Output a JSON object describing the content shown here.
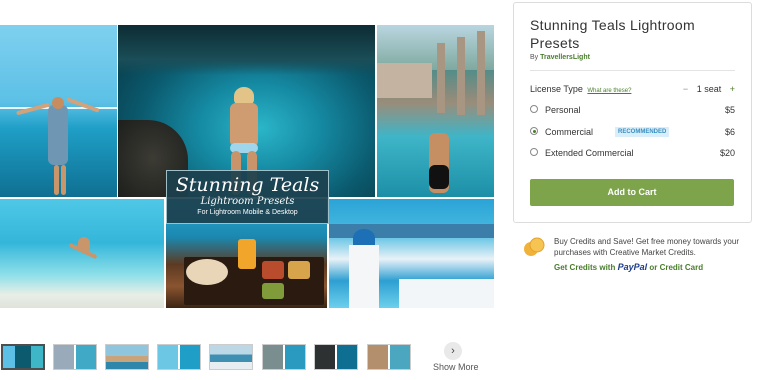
{
  "gallery": {
    "overlay_title": "Stunning Teals",
    "overlay_subtitle": "Lightroom Presets",
    "overlay_caption": "For Lightroom Mobile & Desktop",
    "show_more_icon": "chevron-right-icon",
    "show_more_label": "Show More",
    "thumbnail_count": 8
  },
  "product": {
    "title": "Stunning Teals Lightroom Presets",
    "by_prefix": "By",
    "shop_name": "TravellersLight",
    "license_label": "License Type",
    "what_link": "What are these?",
    "seat_minus": "−",
    "seat_value": "1 seat",
    "seat_plus": "+",
    "options": [
      {
        "name": "Personal",
        "price": "$5",
        "selected": false,
        "badge": ""
      },
      {
        "name": "Commercial",
        "price": "$6",
        "selected": true,
        "badge": "RECOMMENDED"
      },
      {
        "name": "Extended Commercial",
        "price": "$20",
        "selected": false,
        "badge": ""
      }
    ],
    "add_to_cart": "Add to Cart"
  },
  "credits": {
    "text": "Buy Credits and Save! Get free money towards your purchases with Creative Market Credits.",
    "link_prefix": "Get Credits with",
    "paypal": "PayPal",
    "link_suffix": "or Credit Card"
  },
  "colors": {
    "accent_green": "#7da44a",
    "link_green": "#4a7d2c",
    "badge_bg": "#d8eefb"
  }
}
